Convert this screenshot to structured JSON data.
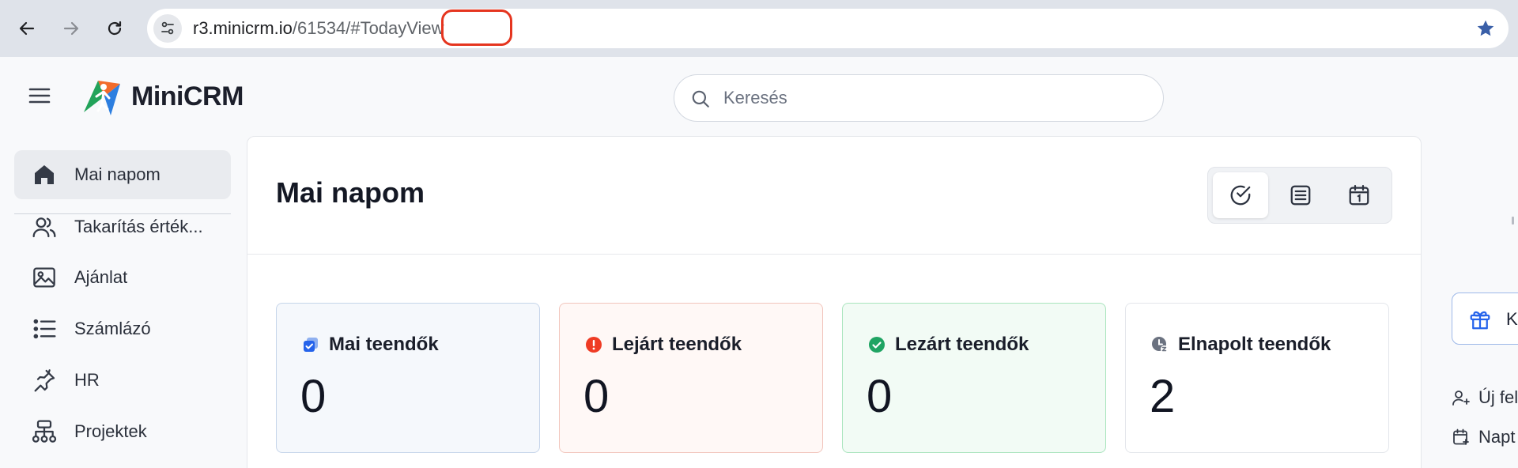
{
  "browser": {
    "url_host": "r3.minicrm.io",
    "url_path_prefix": "/",
    "url_highlighted": "61534",
    "url_path_suffix": "/#TodayView",
    "highlight_color": "#e5351f"
  },
  "header": {
    "logo_text": "MiniCRM",
    "search_placeholder": "Keresés"
  },
  "sidebar": {
    "items": [
      {
        "label": "Mai napom",
        "icon": "home-icon",
        "active": true
      },
      {
        "label": "Takarítás érték...",
        "icon": "users-icon"
      },
      {
        "label": "Ajánlat",
        "icon": "image-icon"
      },
      {
        "label": "Számlázó",
        "icon": "list-icon"
      },
      {
        "label": "HR",
        "icon": "pin-icon"
      },
      {
        "label": "Projektek",
        "icon": "sitemap-icon"
      }
    ]
  },
  "main": {
    "title": "Mai napom",
    "view_buttons": [
      {
        "icon": "check-circle-icon",
        "active": true
      },
      {
        "icon": "list-view-icon"
      },
      {
        "icon": "calendar-icon"
      }
    ],
    "cards": [
      {
        "title": "Mai teendők",
        "count": "0",
        "icon": "tasks-icon",
        "bg": "#f5f8fc",
        "border": "#c6d5ea",
        "icon_color": "#2563eb"
      },
      {
        "title": "Lejárt teendők",
        "count": "0",
        "icon": "alert-icon",
        "bg": "#fff8f6",
        "border": "#f2c5bc",
        "icon_color": "#ef3b24"
      },
      {
        "title": "Lezárt teendők",
        "count": "0",
        "icon": "check-icon",
        "bg": "#f2fbf5",
        "border": "#a9e4bd",
        "icon_color": "#1fa463"
      },
      {
        "title": "Elnapolt teendők",
        "count": "2",
        "icon": "clock-icon",
        "bg": "#ffffff",
        "border": "#e3e6eb",
        "icon_color": "#6b7280"
      }
    ]
  },
  "right_panel": {
    "gift_label": "K",
    "links": [
      {
        "label": "Új fel",
        "icon": "add-user-icon"
      },
      {
        "label": "Napt",
        "icon": "calendar-add-icon"
      }
    ]
  }
}
